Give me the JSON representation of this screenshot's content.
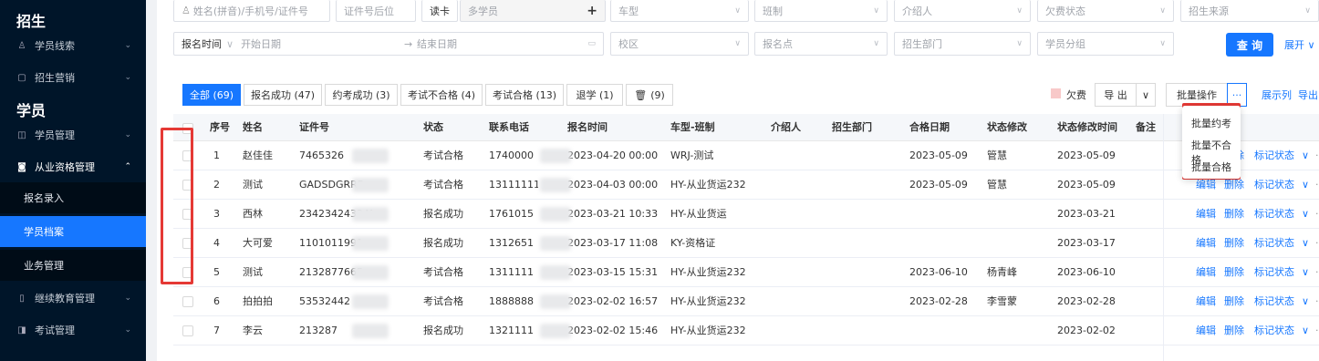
{
  "sidebar": {
    "group_enroll": "招生",
    "item_student_leads": "学员线索",
    "item_enroll_marketing": "招生营销",
    "group_student": "学员",
    "item_student_mgmt": "学员管理",
    "item_qualification_mgmt": "从业资格管理",
    "sub_enroll_entry": "报名录入",
    "sub_student_archive": "学员档案",
    "sub_business_mgmt": "业务管理",
    "item_continuing_edu": "继续教育管理",
    "item_exam_mgmt": "考试管理"
  },
  "filters": {
    "name_placeholder": "姓名(拼音)/手机号/证件号",
    "id_suffix_placeholder": "证件号后位",
    "card_reader": "读卡",
    "multi_student": "多学员",
    "add": "+",
    "car_type": "车型",
    "class_type": "班制",
    "referrer": "介绍人",
    "owe_status": "欠费状态",
    "enroll_source": "招生来源",
    "signup_time_label": "报名时间",
    "start_date": "开始日期",
    "range_arrow": "→",
    "end_date": "结束日期",
    "campus": "校区",
    "signup_point": "报名点",
    "enroll_dept": "招生部门",
    "student_group": "学员分组",
    "query_button": "查 询",
    "expand": "展开"
  },
  "tabs": [
    {
      "label": "全部 (69)"
    },
    {
      "label": "报名成功 (47)"
    },
    {
      "label": "约考成功 (3)"
    },
    {
      "label": "考试不合格 (4)"
    },
    {
      "label": "考试合格 (13)"
    },
    {
      "label": "退学 (1)"
    },
    {
      "label": "(9)"
    }
  ],
  "toolbar": {
    "owe_legend": "欠费",
    "export": "导 出",
    "batch_ops": "批量操作",
    "more": "···",
    "show_columns": "展示列",
    "export_link": "导出"
  },
  "table": {
    "headers": {
      "seq": "序号",
      "name": "姓名",
      "id_no": "证件号",
      "status": "状态",
      "phone": "联系电话",
      "signup_time": "报名时间",
      "car_class": "车型-班制",
      "referrer": "介绍人",
      "dept": "招生部门",
      "pass_date": "合格日期",
      "status_editor": "状态修改",
      "status_time": "状态修改时间",
      "remark": "备注"
    },
    "rows": [
      {
        "seq": "1",
        "name": "赵佳佳",
        "id_no": "7465326",
        "status": "考试合格",
        "phone": "1740000",
        "signup_time": "2023-04-20 00:00",
        "car_class": "WRJ-测试",
        "pass_date": "2023-05-09",
        "editor": "管慧",
        "status_time": "2023-05-09"
      },
      {
        "seq": "2",
        "name": "测试",
        "id_no": "GADSDGRRF",
        "status": "考试合格",
        "phone": "131111111",
        "signup_time": "2023-04-03 00:00",
        "car_class": "HY-从业货运232",
        "pass_date": "2023-05-09",
        "editor": "管慧",
        "status_time": "2023-05-09"
      },
      {
        "seq": "3",
        "name": "西林",
        "id_no": "234234243242424",
        "status": "报名成功",
        "phone": "1761015",
        "signup_time": "2023-03-21 10:33",
        "car_class": "HY-从业货运",
        "pass_date": "",
        "editor": "",
        "status_time": "2023-03-21"
      },
      {
        "seq": "4",
        "name": "大可爱",
        "id_no": "1101011991",
        "status": "报名成功",
        "phone": "1312651",
        "signup_time": "2023-03-17 11:08",
        "car_class": "KY-资格证",
        "pass_date": "",
        "editor": "",
        "status_time": "2023-03-17"
      },
      {
        "seq": "5",
        "name": "测试",
        "id_no": "2132877665",
        "status": "考试合格",
        "phone": "1311111",
        "signup_time": "2023-03-15 15:31",
        "car_class": "HY-从业货运232",
        "pass_date": "2023-06-10",
        "editor": "杨青峰",
        "status_time": "2023-06-10"
      },
      {
        "seq": "6",
        "name": "拍拍拍",
        "id_no": "53532442",
        "status": "考试合格",
        "phone": "1888888",
        "signup_time": "2023-02-02 16:57",
        "car_class": "HY-从业货运232",
        "pass_date": "2023-02-28",
        "editor": "李雪蒙",
        "status_time": "2023-02-28"
      },
      {
        "seq": "7",
        "name": "李云",
        "id_no": "213287",
        "status": "报名成功",
        "phone": "1321111",
        "signup_time": "2023-02-02 15:46",
        "car_class": "HY-从业货运232",
        "pass_date": "",
        "editor": "",
        "status_time": "2023-02-02"
      }
    ],
    "actions": {
      "edit": "编辑",
      "delete": "删除",
      "mark_status": "标记状态",
      "chevron": "∨",
      "more": "···"
    }
  },
  "batch_dropdown": {
    "items": [
      "批量约考",
      "批量不合格",
      "批量合格"
    ]
  },
  "colors": {
    "primary": "#1677ff",
    "sidebar_bg": "#001529",
    "highlight": "#e53935",
    "owe_legend": "#f8c9c9"
  }
}
